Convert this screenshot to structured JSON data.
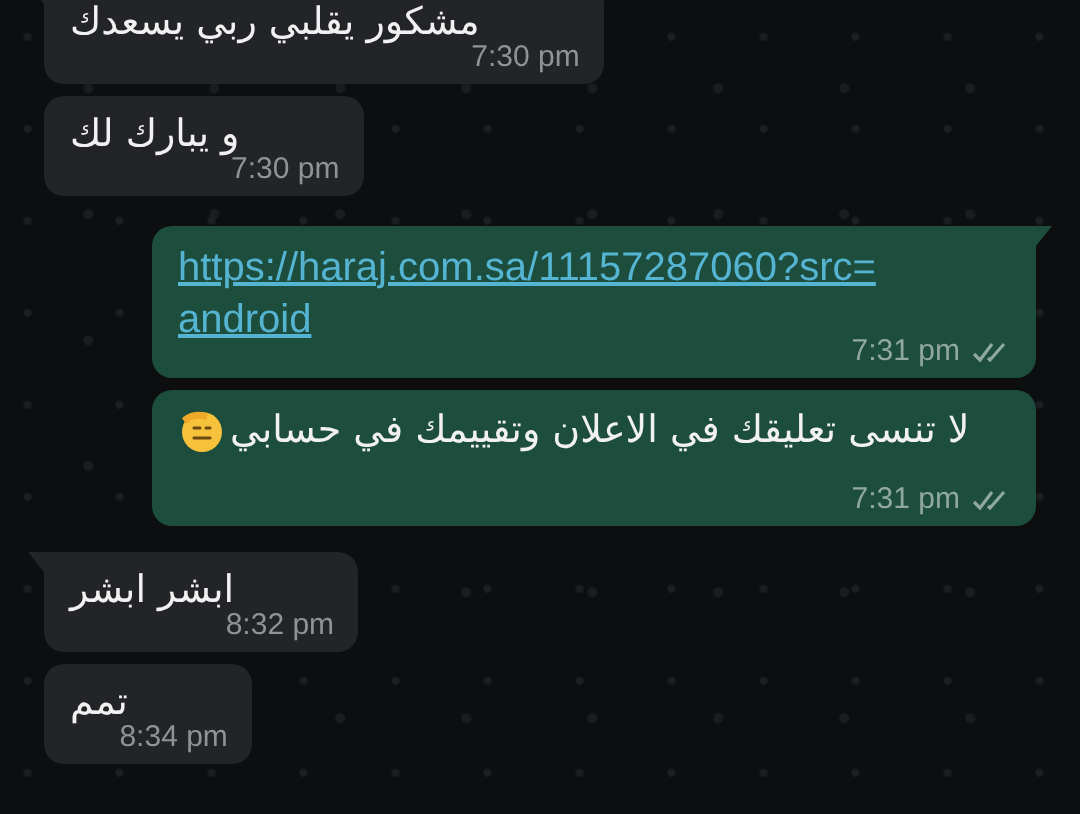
{
  "messages": [
    {
      "kind": "in",
      "tail": true,
      "text": "مشكور يقلبي ربي يسعدك",
      "time": "7:30 pm"
    },
    {
      "kind": "in",
      "tail": false,
      "text": "و يبارك لك",
      "time": "7:30 pm"
    },
    {
      "kind": "link",
      "tail": true,
      "link_lines": [
        "https://haraj.com.sa/11157287060?src=",
        "android"
      ],
      "time": "7:31 pm",
      "double_tick": true
    },
    {
      "kind": "out",
      "tail": false,
      "text": "لا تنسى تعليقك في الاعلان وتقييمك  في حسابي",
      "salute_emoji": true,
      "time": "7:31 pm",
      "double_tick": true
    },
    {
      "kind": "in",
      "tail": true,
      "text": "ابشر ابشر",
      "time": "8:32 pm"
    },
    {
      "kind": "in",
      "tail": false,
      "text": "تمم",
      "time": "8:34 pm"
    }
  ]
}
